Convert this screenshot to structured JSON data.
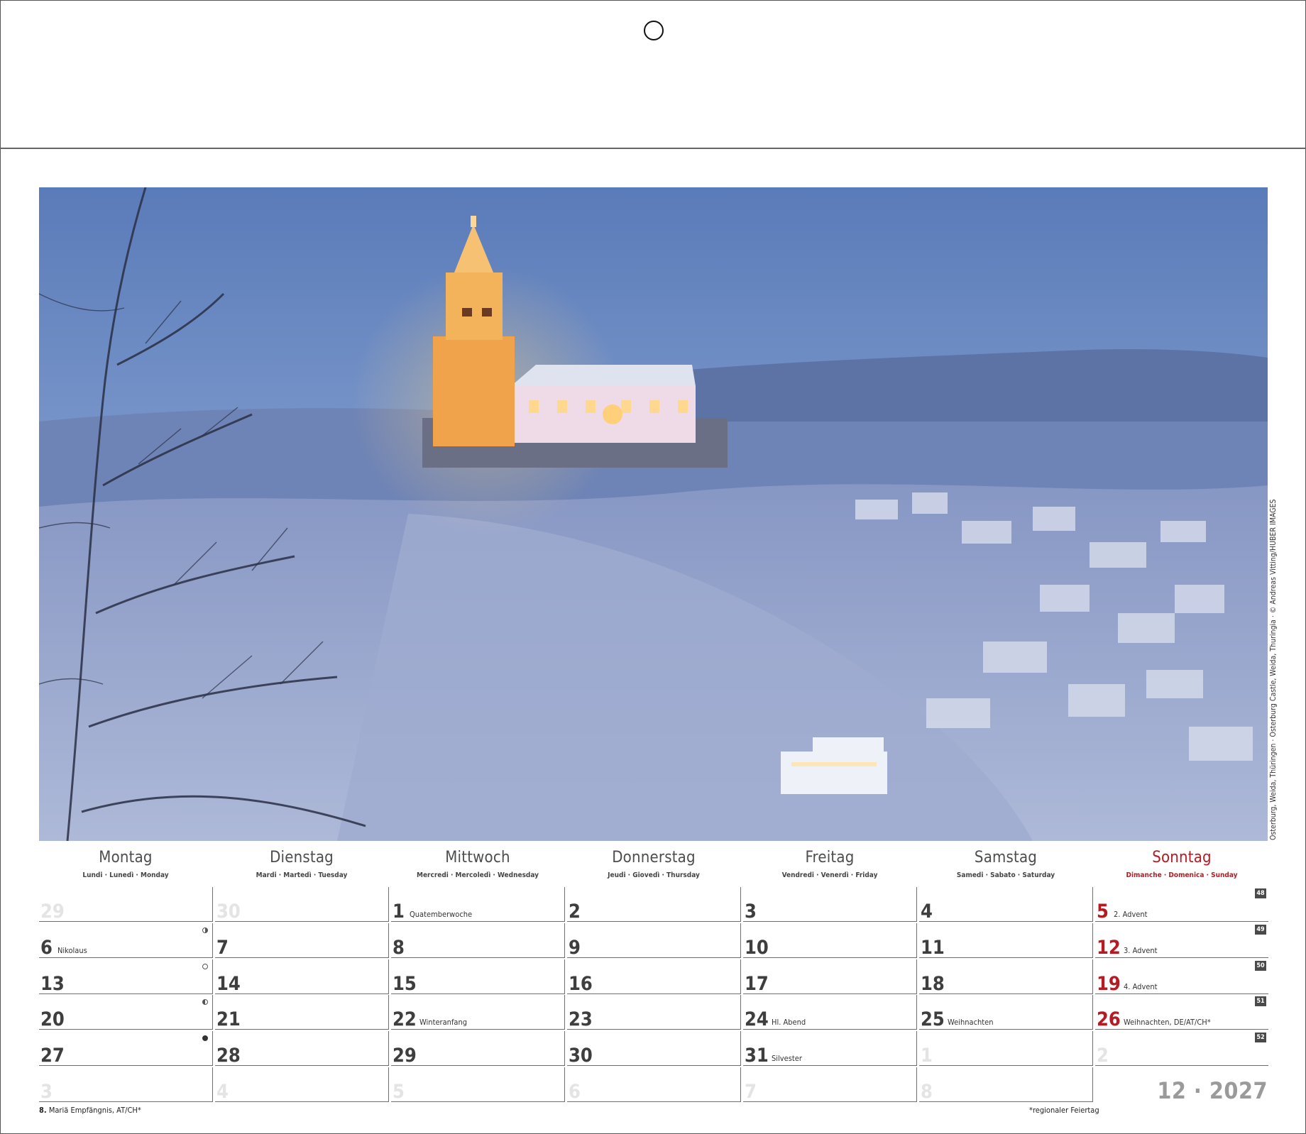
{
  "photo": {
    "credit": "Osterburg, Weida, Thüringen · Osterburg Castle, Weida, Thuringia · © Andreas Vitting/HUBER IMAGES"
  },
  "weekdays": [
    {
      "name": "Montag",
      "sub": "Lundi · Lunedì · Monday"
    },
    {
      "name": "Dienstag",
      "sub": "Mardi · Martedì · Tuesday"
    },
    {
      "name": "Mittwoch",
      "sub": "Mercredi · Mercoledì · Wednesday"
    },
    {
      "name": "Donnerstag",
      "sub": "Jeudi · Giovedì · Thursday"
    },
    {
      "name": "Freitag",
      "sub": "Vendredi · Venerdì · Friday"
    },
    {
      "name": "Samstag",
      "sub": "Samedi · Sabato · Saturday"
    },
    {
      "name": "Sonntag",
      "sub": "Dimanche · Domenica · Sunday"
    }
  ],
  "weeks": [
    {
      "kw": "48",
      "days": [
        {
          "n": "29",
          "dim": true
        },
        {
          "n": "30",
          "dim": true
        },
        {
          "n": "1",
          "note": "Quatemberwoche"
        },
        {
          "n": "2"
        },
        {
          "n": "3"
        },
        {
          "n": "4"
        },
        {
          "n": "5",
          "note": "2. Advent",
          "red": true
        }
      ]
    },
    {
      "kw": "49",
      "days": [
        {
          "n": "6",
          "note": "Nikolaus",
          "moon": "half-r"
        },
        {
          "n": "7"
        },
        {
          "n": "8"
        },
        {
          "n": "9"
        },
        {
          "n": "10"
        },
        {
          "n": "11"
        },
        {
          "n": "12",
          "note": "3. Advent",
          "red": true
        }
      ]
    },
    {
      "kw": "50",
      "days": [
        {
          "n": "13",
          "moon": "full"
        },
        {
          "n": "14"
        },
        {
          "n": "15"
        },
        {
          "n": "16"
        },
        {
          "n": "17"
        },
        {
          "n": "18"
        },
        {
          "n": "19",
          "note": "4. Advent",
          "red": true
        }
      ]
    },
    {
      "kw": "51",
      "days": [
        {
          "n": "20",
          "moon": "half-l"
        },
        {
          "n": "21"
        },
        {
          "n": "22",
          "note": "Winteranfang"
        },
        {
          "n": "23"
        },
        {
          "n": "24",
          "note": "Hl. Abend"
        },
        {
          "n": "25",
          "note": "Weihnachten"
        },
        {
          "n": "26",
          "note": "Weihnachten, DE/AT/CH*",
          "red": true
        }
      ]
    },
    {
      "kw": "52",
      "days": [
        {
          "n": "27",
          "moon": "new"
        },
        {
          "n": "28"
        },
        {
          "n": "29"
        },
        {
          "n": "30"
        },
        {
          "n": "31",
          "note": "Silvester"
        },
        {
          "n": "1",
          "dim": true
        },
        {
          "n": "2",
          "dim": true
        }
      ]
    },
    {
      "kw": "",
      "days": [
        {
          "n": "3",
          "dim": true
        },
        {
          "n": "4",
          "dim": true
        },
        {
          "n": "5",
          "dim": true
        },
        {
          "n": "6",
          "dim": true
        },
        {
          "n": "7",
          "dim": true
        },
        {
          "n": "8",
          "dim": true
        }
      ]
    }
  ],
  "month_year": "12 · 2027",
  "footnote_left_num": "8.",
  "footnote_left_text": "Mariä Empfängnis, AT/CH*",
  "footnote_right": "*regionaler Feiertag"
}
